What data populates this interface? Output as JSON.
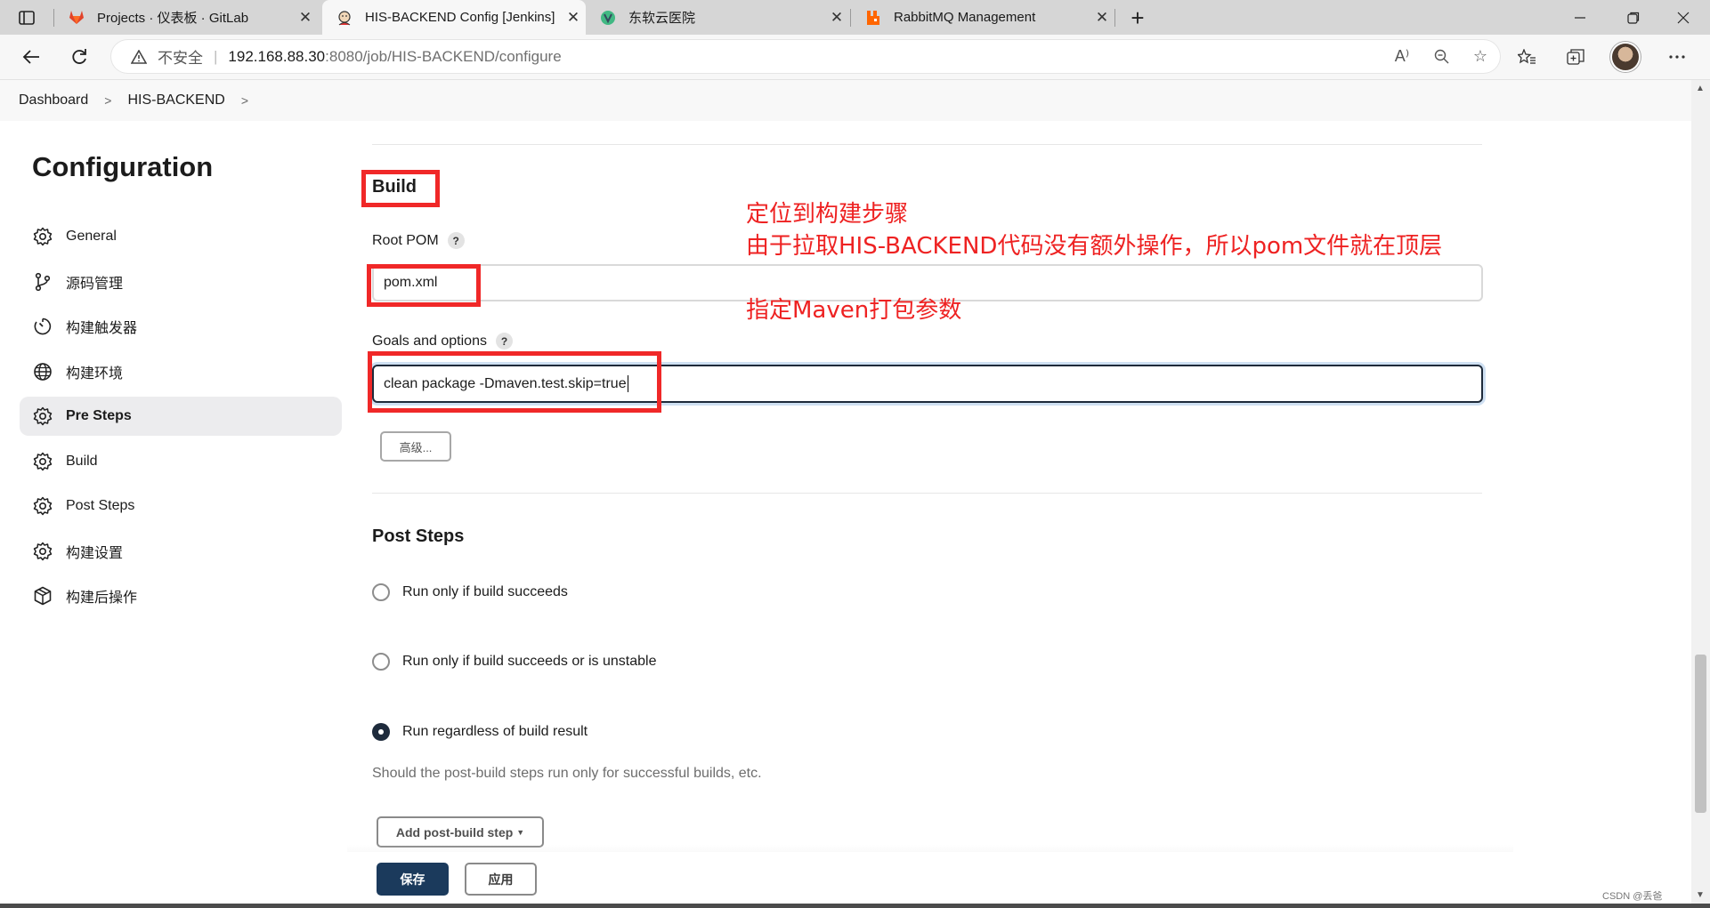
{
  "browser": {
    "tabs": [
      {
        "title": "Projects · 仪表板 · GitLab",
        "favicon": "gitlab-icon"
      },
      {
        "title": "HIS-BACKEND Config [Jenkins]",
        "favicon": "jenkins-icon",
        "active": true
      },
      {
        "title": "东软云医院",
        "favicon": "vue-icon"
      },
      {
        "title": "RabbitMQ Management",
        "favicon": "rabbitmq-icon"
      }
    ],
    "tab_close": "✕",
    "new_tab": "+",
    "insecure_label": "不安全",
    "url_host": "192.168.88.30",
    "url_path": ":8080/job/HIS-BACKEND/configure"
  },
  "breadcrumb": {
    "items": [
      "Dashboard",
      "HIS-BACKEND"
    ]
  },
  "page": {
    "title": "Configuration"
  },
  "sidenav": {
    "items": [
      {
        "label": "General",
        "icon": "gear-icon"
      },
      {
        "label": "源码管理",
        "icon": "branch-icon"
      },
      {
        "label": "构建触发器",
        "icon": "clock-icon"
      },
      {
        "label": "构建环境",
        "icon": "globe-icon"
      },
      {
        "label": "Pre Steps",
        "icon": "gear-icon",
        "active": true
      },
      {
        "label": "Build",
        "icon": "gear-icon"
      },
      {
        "label": "Post Steps",
        "icon": "gear-icon"
      },
      {
        "label": "构建设置",
        "icon": "gear-icon"
      },
      {
        "label": "构建后操作",
        "icon": "package-icon"
      }
    ]
  },
  "build": {
    "title": "Build",
    "root_pom_label": "Root POM",
    "root_pom_value": "pom.xml",
    "goals_label": "Goals and options",
    "goals_value": "clean package -Dmaven.test.skip=true",
    "help_glyph": "?",
    "advanced_button": "高级..."
  },
  "post_steps": {
    "title": "Post Steps",
    "options": [
      {
        "label": "Run only if build succeeds",
        "checked": false
      },
      {
        "label": "Run only if build succeeds or is unstable",
        "checked": false
      },
      {
        "label": "Run regardless of build result",
        "checked": true
      }
    ],
    "help_text": "Should the post-build steps run only for successful builds, etc.",
    "add_button": "Add post-build step"
  },
  "footer": {
    "save_button": "保存",
    "apply_button": "应用"
  },
  "annotations": {
    "line1": "定位到构建步骤",
    "line2": "由于拉取HIS-BACKEND代码没有额外操作，所以pom文件就在顶层",
    "line3": "指定Maven打包参数",
    "color": "#ee2222"
  },
  "watermark": "CSDN @丢爸",
  "colors": {
    "accent": "#1b3a5c",
    "annotation": "#f02828"
  }
}
